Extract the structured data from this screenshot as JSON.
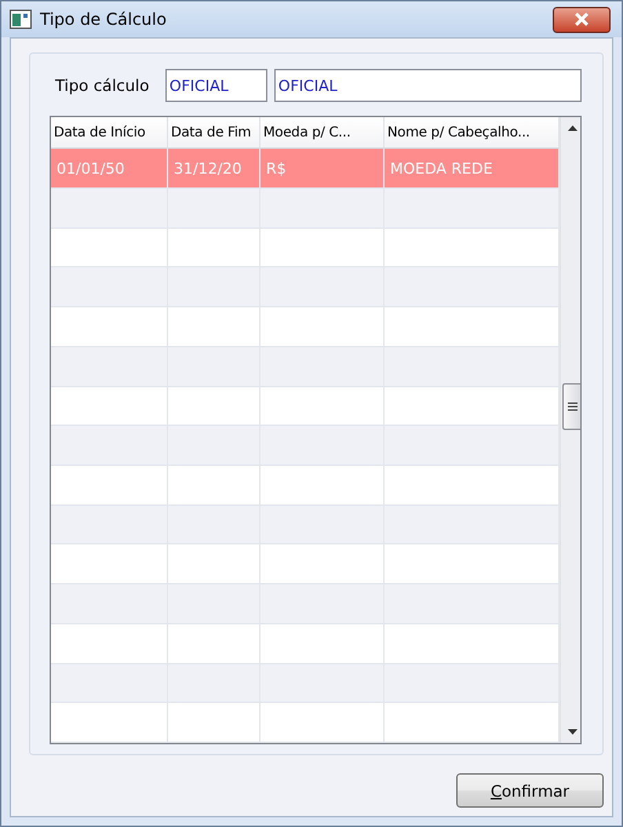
{
  "window": {
    "title": "Tipo de Cálculo"
  },
  "form": {
    "label": "Tipo cálculo",
    "code": "OFICIAL",
    "description": "OFICIAL"
  },
  "table": {
    "columns": [
      "Data de Início",
      "Data de Fim",
      "Moeda p/ C...",
      "Nome p/ Cabeçalho..."
    ],
    "rows": [
      {
        "cells": [
          "01/01/50",
          "31/12/20",
          "R$",
          "MOEDA REDE"
        ],
        "selected": true
      }
    ]
  },
  "confirm_button": {
    "label": "Confirmar",
    "first_letter_underlined": true
  }
}
